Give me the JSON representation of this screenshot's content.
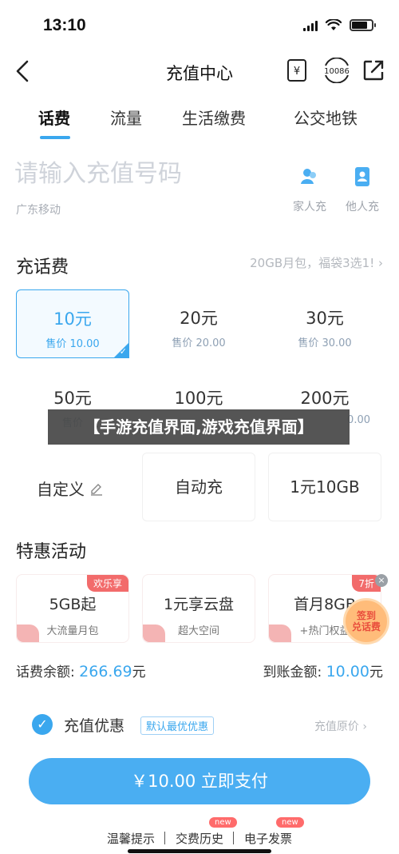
{
  "status_bar": {
    "time": "13:10"
  },
  "nav": {
    "title": "充值中心",
    "icons": [
      "back-arrow-icon",
      "yuan-bill-icon",
      "10086-service-icon",
      "share-icon"
    ],
    "service_number": "10086"
  },
  "tabs": [
    {
      "label": "话费",
      "active": true
    },
    {
      "label": "流量"
    },
    {
      "label": "生活缴费"
    },
    {
      "label": "公交地铁"
    }
  ],
  "phone": {
    "placeholder": "请输入充值号码",
    "carrier": "广东移动"
  },
  "contacts": [
    {
      "label": "家人充",
      "icon": "family-icon"
    },
    {
      "label": "他人充",
      "icon": "contact-card-icon"
    }
  ],
  "recharge": {
    "title": "充话费",
    "promo": "20GB月包，福袋3选1!",
    "amounts": [
      {
        "value": "10元",
        "price": "售价 10.00",
        "selected": true
      },
      {
        "value": "20元",
        "price": "售价 20.00"
      },
      {
        "value": "30元",
        "price": "售价 30.00"
      },
      {
        "value": "50元",
        "price": "售价"
      },
      {
        "value": "100元",
        "price": ""
      },
      {
        "value": "200元",
        "price": "0.00"
      }
    ],
    "options": [
      "自定义",
      "自动充",
      "1元10GB"
    ]
  },
  "banner": "【手游充值界面,游戏充值界面】",
  "deals": {
    "title": "特惠活动",
    "items": [
      {
        "tag": "欢乐享",
        "title": "5GB起",
        "subtitle": "大流量月包"
      },
      {
        "tag": "",
        "title": "1元享云盘",
        "subtitle": "超大空间"
      },
      {
        "tag": "7折",
        "title": "首月8GB",
        "subtitle": "+热门权益"
      }
    ],
    "coupon": "签到\n兑话费"
  },
  "balance": {
    "label_left": "话费余额:",
    "value_left": "266.69",
    "unit_left": "元",
    "label_right": "到账金额:",
    "value_right": "10.00",
    "unit_right": "元"
  },
  "preference": {
    "label": "充值优惠",
    "tag": "默认最优优惠",
    "right": "充值原价"
  },
  "pay_button": "￥10.00 立即支付",
  "footer": [
    {
      "label": "温馨提示"
    },
    {
      "label": "交费历史",
      "badge": "new"
    },
    {
      "label": "电子发票",
      "badge": "new"
    }
  ],
  "colors": {
    "accent": "#3aa7ee",
    "pay_button": "#4aaef2",
    "deal_tag": "#f26b6b"
  }
}
